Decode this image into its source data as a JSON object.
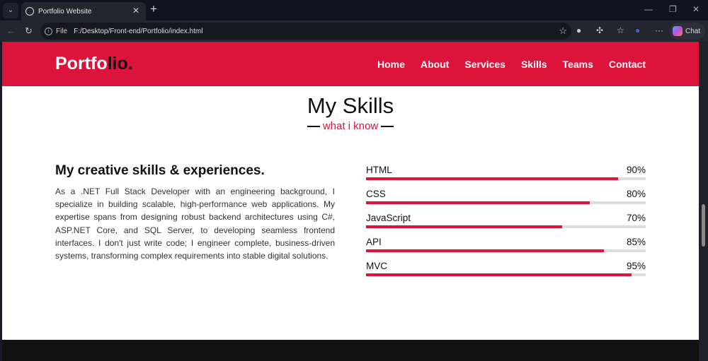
{
  "browser": {
    "tab_title": "Portfolio Website",
    "url_scheme_label": "File",
    "url": "F:/Desktop/Front-end/Portfolio/index.html",
    "chat_label": "Chat"
  },
  "site": {
    "brand_main": "Portfo",
    "brand_accent": "lio.",
    "nav": [
      "Home",
      "About",
      "Services",
      "Skills",
      "Teams",
      "Contact"
    ],
    "section_title": "My Skills",
    "section_subtitle": "what i know",
    "heading": "My creative skills & experiences.",
    "paragraph": "As a .NET Full Stack Developer with an engineering background, I specialize in building scalable, high-performance web applications. My expertise spans from designing robust backend architectures using C#, ASP.NET Core, and SQL Server, to developing seamless frontend interfaces. I don't just write code; I engineer complete, business-driven systems, transforming complex requirements into stable digital solutions.",
    "skills": [
      {
        "name": "HTML",
        "label": "90%",
        "value": 90
      },
      {
        "name": "CSS",
        "label": "80%",
        "value": 80
      },
      {
        "name": "JavaScript",
        "label": "70%",
        "value": 70
      },
      {
        "name": "API",
        "label": "85%",
        "value": 85
      },
      {
        "name": "MVC",
        "label": "95%",
        "value": 95
      }
    ],
    "accent_color": "#dc143c"
  }
}
